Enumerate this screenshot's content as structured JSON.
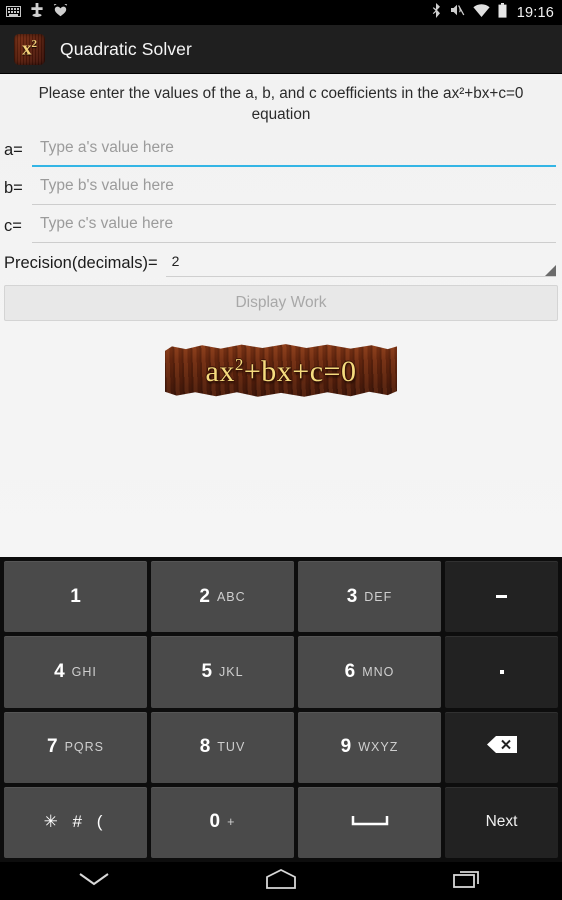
{
  "status_bar": {
    "left_icons": [
      "keyboard-icon",
      "medical-plus-icon",
      "iheartradio-icon"
    ],
    "right_icons": [
      "bluetooth-icon",
      "volume-muted-icon",
      "wifi-icon",
      "battery-icon"
    ],
    "clock": "19:16"
  },
  "action_bar": {
    "app_icon_label": "x",
    "app_icon_sup": "2",
    "title": "Quadratic Solver"
  },
  "main": {
    "instructions": "Please enter the values of the a, b, and c coefficients in the ax²+bx+c=0 equation",
    "fields": [
      {
        "label": "a=",
        "value": "",
        "placeholder": "Type a's value here",
        "focused": true
      },
      {
        "label": "b=",
        "value": "",
        "placeholder": "Type b's value here",
        "focused": false
      },
      {
        "label": "c=",
        "value": "",
        "placeholder": "Type c's value here",
        "focused": false
      }
    ],
    "precision": {
      "label": "Precision(decimals)=",
      "value": "2"
    },
    "display_work_label": "Display Work",
    "plaque": {
      "expr_prefix": "ax",
      "expr_sup": "2",
      "expr_suffix": "+bx+c=0"
    }
  },
  "keyboard": {
    "rows": [
      [
        {
          "digit": "1",
          "letters": "",
          "type": "digit"
        },
        {
          "digit": "2",
          "letters": "ABC",
          "type": "digit"
        },
        {
          "digit": "3",
          "letters": "DEF",
          "type": "digit"
        },
        {
          "digit": "",
          "letters": "",
          "type": "minus"
        }
      ],
      [
        {
          "digit": "4",
          "letters": "GHI",
          "type": "digit"
        },
        {
          "digit": "5",
          "letters": "JKL",
          "type": "digit"
        },
        {
          "digit": "6",
          "letters": "MNO",
          "type": "digit"
        },
        {
          "digit": "",
          "letters": "",
          "type": "dot"
        }
      ],
      [
        {
          "digit": "7",
          "letters": "PQRS",
          "type": "digit"
        },
        {
          "digit": "8",
          "letters": "TUV",
          "type": "digit"
        },
        {
          "digit": "9",
          "letters": "WXYZ",
          "type": "digit"
        },
        {
          "digit": "",
          "letters": "",
          "type": "backspace"
        }
      ],
      [
        {
          "digit": "",
          "letters": "",
          "symbols": "✳ # (",
          "type": "symbols"
        },
        {
          "digit": "0",
          "letters": "+",
          "type": "digit"
        },
        {
          "digit": "",
          "letters": "",
          "type": "space"
        },
        {
          "digit": "",
          "letters": "",
          "next_label": "Next",
          "type": "next"
        }
      ]
    ]
  },
  "nav_bar": {
    "buttons": [
      "hide-keyboard-icon",
      "home-icon",
      "recents-icon"
    ]
  },
  "colors": {
    "accent_blue": "#33b5e5",
    "action_bar": "#1f1f1f",
    "content_bg": "#f2f2f2",
    "key_bg": "#4a4a4a",
    "func_key_bg": "#222222",
    "plaque_text": "#f5dc7e"
  }
}
